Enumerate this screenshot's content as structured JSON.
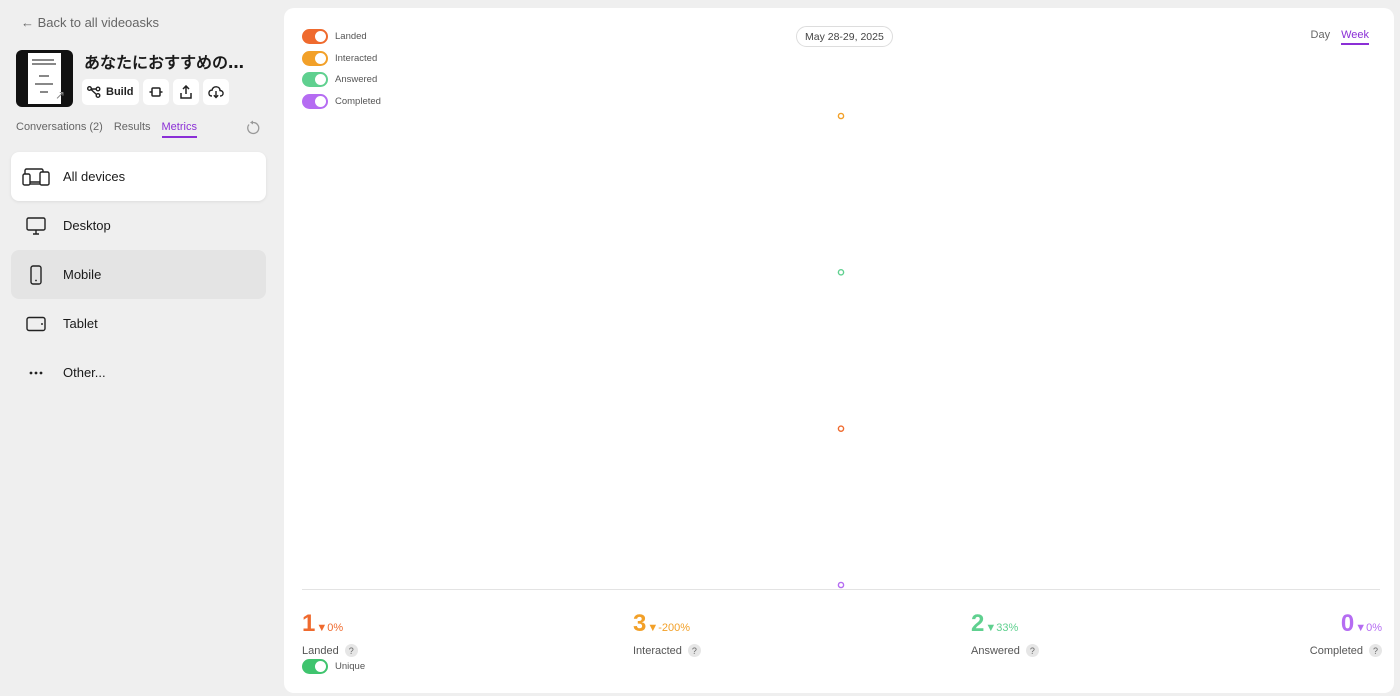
{
  "back_link": "← Back to all videoasks",
  "title": "あなたにおすすめのブ...",
  "toolbar": {
    "build_label": "Build"
  },
  "tabs": [
    {
      "label": "Conversations (2)",
      "active": false
    },
    {
      "label": "Results",
      "active": false
    },
    {
      "label": "Metrics",
      "active": true
    }
  ],
  "devices": [
    {
      "label": "All devices",
      "icon": "devices-icon",
      "state": "selected"
    },
    {
      "label": "Desktop",
      "icon": "desktop-icon",
      "state": ""
    },
    {
      "label": "Mobile",
      "icon": "mobile-icon",
      "state": "hover"
    },
    {
      "label": "Tablet",
      "icon": "tablet-icon",
      "state": ""
    },
    {
      "label": "Other...",
      "icon": "more-icon",
      "state": ""
    }
  ],
  "legend": [
    {
      "label": "Landed",
      "color": "#ef6a2e",
      "on": true
    },
    {
      "label": "Interacted",
      "color": "#f2a028",
      "on": true
    },
    {
      "label": "Answered",
      "color": "#5fd08f",
      "on": true
    },
    {
      "label": "Completed",
      "color": "#b56cf2",
      "on": true
    }
  ],
  "date_range": "May 28-29, 2025",
  "range_options": [
    {
      "label": "Day",
      "active": false
    },
    {
      "label": "Week",
      "active": true
    }
  ],
  "chart_data": {
    "type": "scatter",
    "x": [
      "May 28-29, 2025"
    ],
    "series": [
      {
        "name": "Interacted",
        "color": "#f2a028",
        "values": [
          3
        ]
      },
      {
        "name": "Answered",
        "color": "#5fd08f",
        "values": [
          2
        ]
      },
      {
        "name": "Landed",
        "color": "#ef6a2e",
        "values": [
          1
        ]
      },
      {
        "name": "Completed",
        "color": "#b56cf2",
        "values": [
          0
        ]
      }
    ],
    "ylim": [
      0,
      3
    ],
    "grid": false
  },
  "stats": [
    {
      "value": "1",
      "delta": "▼0%",
      "label": "Landed",
      "color": "#ef6a2e"
    },
    {
      "value": "3",
      "delta": "▼-200%",
      "label": "Interacted",
      "color": "#f2a028"
    },
    {
      "value": "2",
      "delta": "▼33%",
      "label": "Answered",
      "color": "#5fd08f"
    },
    {
      "value": "0",
      "delta": "▼0%",
      "label": "Completed",
      "color": "#b56cf2"
    }
  ],
  "help_mark": "?",
  "unique_toggle": {
    "label": "Unique",
    "color": "#3fc46e",
    "on": true
  }
}
